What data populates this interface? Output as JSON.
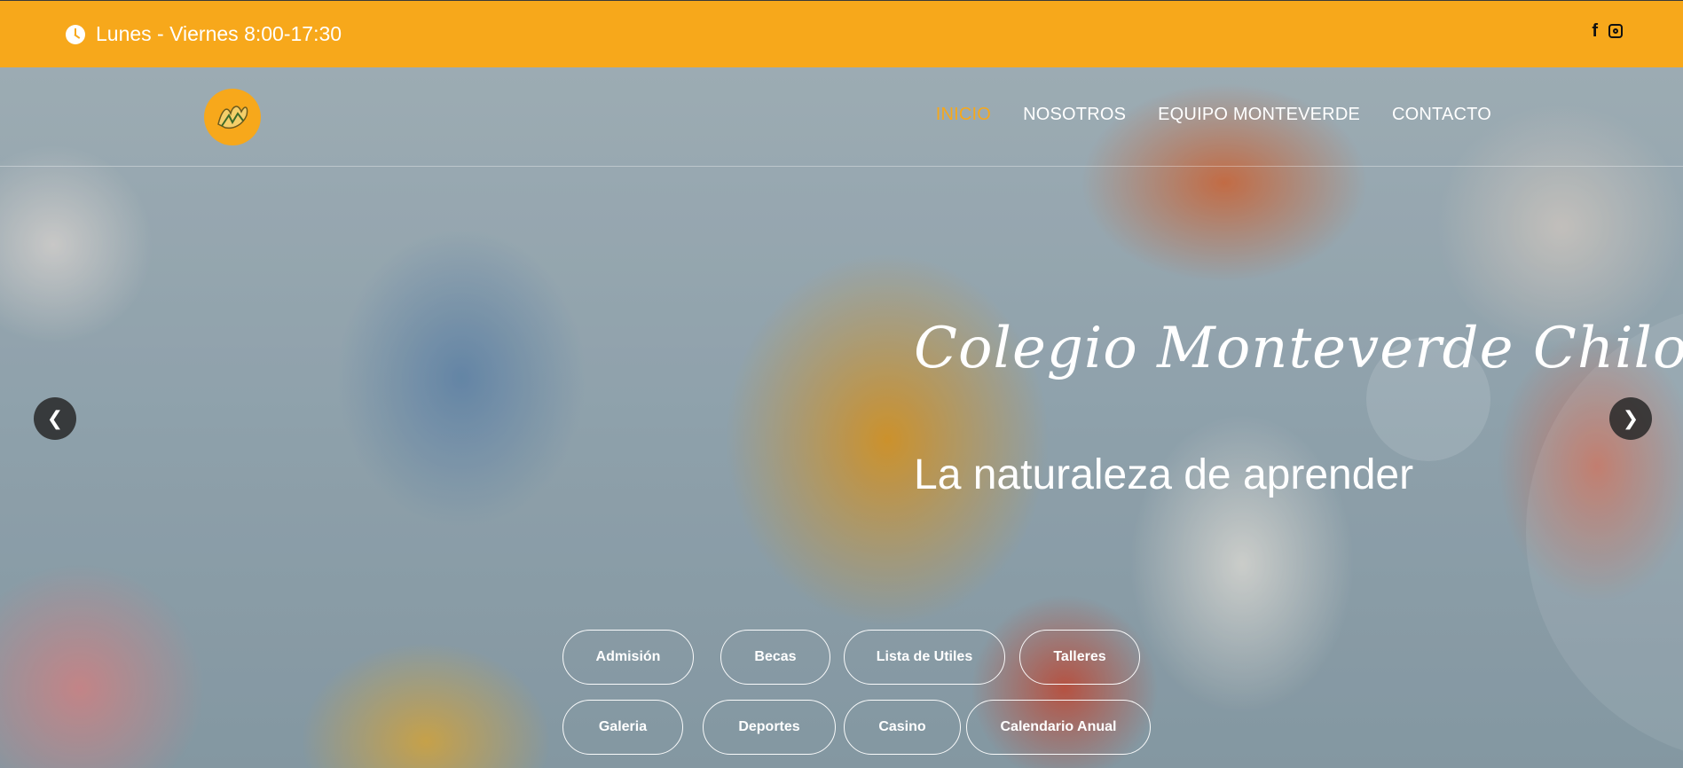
{
  "topbar": {
    "hours": "Lunes - Viernes 8:00-17:30",
    "social": [
      {
        "label": "f",
        "icon": "facebook-icon"
      },
      {
        "label": "",
        "icon": "instagram-icon"
      }
    ],
    "color": "#f7a81b"
  },
  "nav": {
    "items": [
      {
        "label": "INICIO",
        "active": true
      },
      {
        "label": "NOSOTROS",
        "active": false
      },
      {
        "label": "EQUIPO MONTEVERDE",
        "active": false
      },
      {
        "label": "CONTACTO",
        "active": false
      }
    ],
    "active_color": "#f7a81b"
  },
  "hero": {
    "title": "Colegio Monteverde Chiloé",
    "subtitle": "La naturaleza de aprender"
  },
  "slider": {
    "prev_icon": "chevron-left-icon",
    "next_icon": "chevron-right-icon"
  },
  "buttons": {
    "row1": [
      "Admisión",
      "Becas",
      "Lista de Utiles",
      "Talleres"
    ],
    "row2": [
      "Galeria",
      "Deportes",
      "Casino",
      "Calendario Anual"
    ]
  }
}
